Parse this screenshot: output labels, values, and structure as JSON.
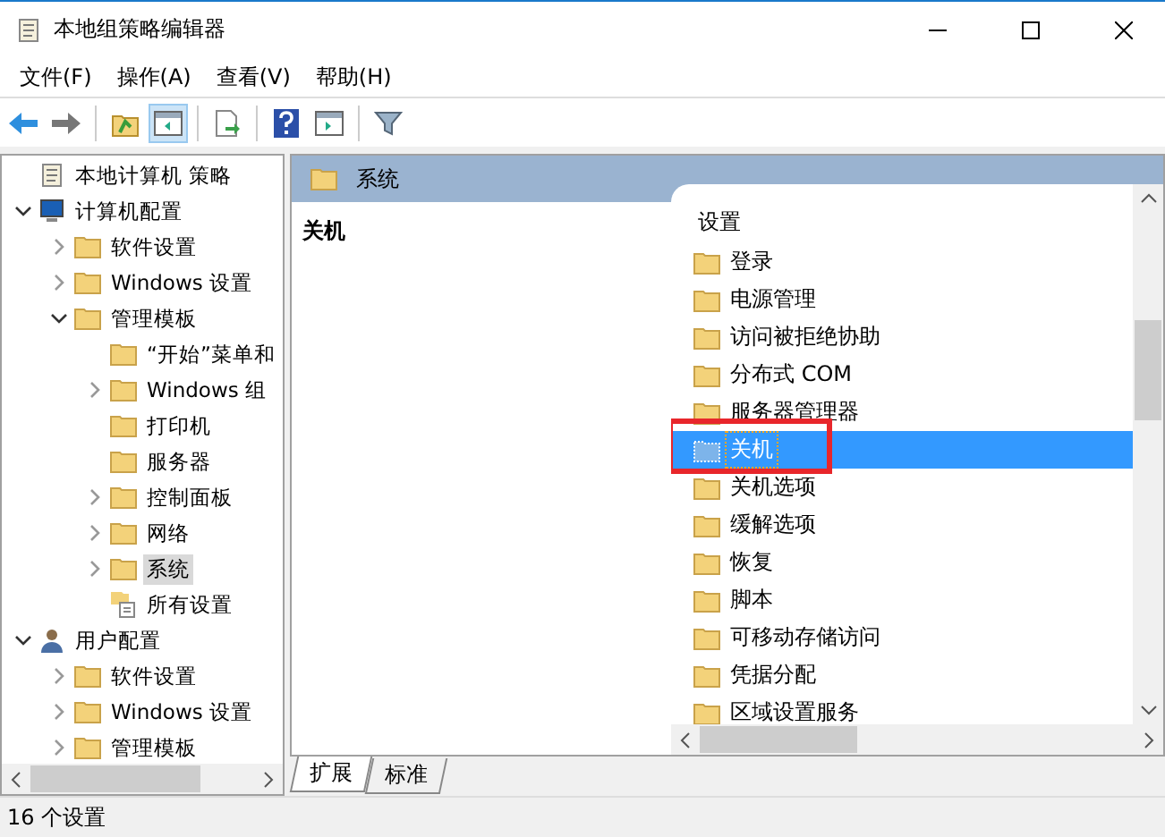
{
  "window": {
    "title": "本地组策略编辑器"
  },
  "menu": [
    "文件(F)",
    "操作(A)",
    "查看(V)",
    "帮助(H)"
  ],
  "toolbar": [
    [
      {
        "kind": "back",
        "pressed": false
      },
      {
        "kind": "forward",
        "pressed": false
      }
    ],
    [
      {
        "kind": "up",
        "pressed": false
      },
      {
        "kind": "tree",
        "pressed": true
      }
    ],
    [
      {
        "kind": "export",
        "pressed": false
      }
    ],
    [
      {
        "kind": "help",
        "pressed": false
      },
      {
        "kind": "pane",
        "pressed": false
      }
    ],
    [
      {
        "kind": "filter",
        "pressed": false
      }
    ]
  ],
  "tree": [
    {
      "label": "本地计算机 策略",
      "kind": "policy",
      "selected": false,
      "children": [
        {
          "label": "计算机配置",
          "kind": "computer",
          "expanded": true,
          "selected": false,
          "children": [
            {
              "label": "软件设置",
              "kind": "folder",
              "expanded": false,
              "selected": false
            },
            {
              "label": "Windows 设置",
              "kind": "folder",
              "expanded": false,
              "selected": false
            },
            {
              "label": "管理模板",
              "kind": "folder",
              "expanded": true,
              "selected": false,
              "children": [
                {
                  "label": "“开始”菜单和",
                  "kind": "folder",
                  "selected": false
                },
                {
                  "label": "Windows 组",
                  "kind": "folder",
                  "expanded": false,
                  "selected": false
                },
                {
                  "label": "打印机",
                  "kind": "folder",
                  "selected": false
                },
                {
                  "label": "服务器",
                  "kind": "folder",
                  "selected": false
                },
                {
                  "label": "控制面板",
                  "kind": "folder",
                  "expanded": false,
                  "selected": false
                },
                {
                  "label": "网络",
                  "kind": "folder",
                  "expanded": false,
                  "selected": false
                },
                {
                  "label": "系统",
                  "kind": "folder",
                  "expanded": false,
                  "selected": true
                },
                {
                  "label": "所有设置",
                  "kind": "settings",
                  "selected": false
                }
              ]
            }
          ]
        },
        {
          "label": "用户配置",
          "kind": "users",
          "expanded": true,
          "selected": false,
          "children": [
            {
              "label": "软件设置",
              "kind": "folder",
              "expanded": false,
              "selected": false
            },
            {
              "label": "Windows 设置",
              "kind": "folder",
              "expanded": false,
              "selected": false
            },
            {
              "label": "管理模板",
              "kind": "folder",
              "expanded": false,
              "selected": false
            }
          ]
        }
      ]
    }
  ],
  "header": {
    "title": "系统"
  },
  "description": {
    "title": "关机"
  },
  "list": {
    "column": "设置",
    "items": [
      {
        "label": "登录",
        "selected": false,
        "highlighted": false
      },
      {
        "label": "电源管理",
        "selected": false,
        "highlighted": false
      },
      {
        "label": "访问被拒绝协助",
        "selected": false,
        "highlighted": false
      },
      {
        "label": "分布式 COM",
        "selected": false,
        "highlighted": false
      },
      {
        "label": "服务器管理器",
        "selected": false,
        "highlighted": false
      },
      {
        "label": "关机",
        "selected": true,
        "highlighted": true
      },
      {
        "label": "关机选项",
        "selected": false,
        "highlighted": false
      },
      {
        "label": "缓解选项",
        "selected": false,
        "highlighted": false
      },
      {
        "label": "恢复",
        "selected": false,
        "highlighted": false
      },
      {
        "label": "脚本",
        "selected": false,
        "highlighted": false
      },
      {
        "label": "可移动存储访问",
        "selected": false,
        "highlighted": false
      },
      {
        "label": "凭据分配",
        "selected": false,
        "highlighted": false
      },
      {
        "label": "区域设置服务",
        "selected": false,
        "highlighted": false
      }
    ]
  },
  "tabs": [
    {
      "label": "扩展",
      "selected": true
    },
    {
      "label": "标准",
      "selected": false
    }
  ],
  "status_bar": "16 个设置"
}
